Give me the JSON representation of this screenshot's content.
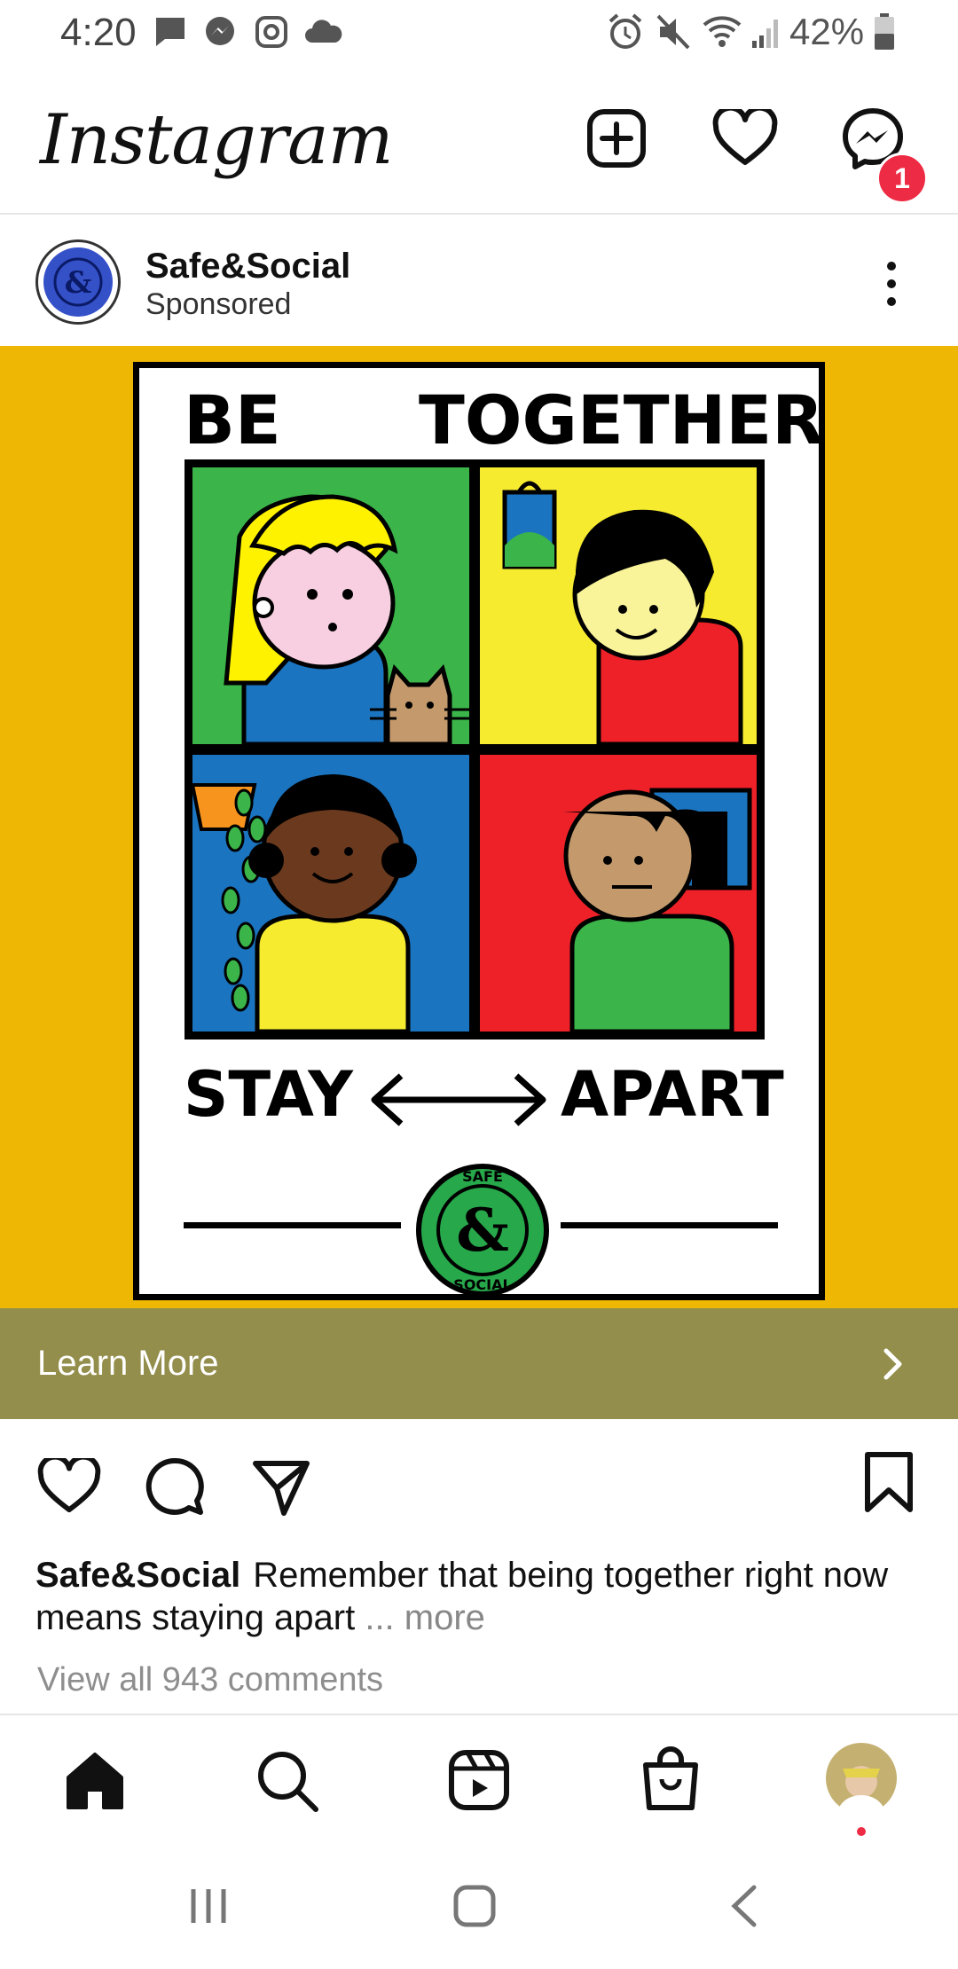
{
  "status_bar": {
    "time": "4:20",
    "battery": "42%",
    "notification_icons": [
      "chat-icon",
      "messenger-icon",
      "instagram-icon",
      "cloud-icon"
    ],
    "system_icons": [
      "alarm-icon",
      "mute-icon",
      "wifi-icon",
      "signal-icon",
      "battery-icon"
    ]
  },
  "header": {
    "app_title": "Instagram",
    "messages_badge": "1"
  },
  "post": {
    "account_name": "Safe&Social",
    "label": "Sponsored",
    "poster": {
      "top_left": "BE",
      "top_right": "TOGETHER",
      "bottom_left": "STAY",
      "bottom_right": "APART",
      "seal_top": "SAFE",
      "seal_bottom": "SOCIAL",
      "seal_symbol": "&"
    },
    "cta_label": "Learn More",
    "caption_name": "Safe&Social",
    "caption_text": "Remember that being together right now means staying apart",
    "caption_more": "... more",
    "comments_link": "View all 943 comments"
  },
  "colors": {
    "ad_background": "#eeb704",
    "cta_background": "#948e4c",
    "badge": "#ee2b44"
  }
}
